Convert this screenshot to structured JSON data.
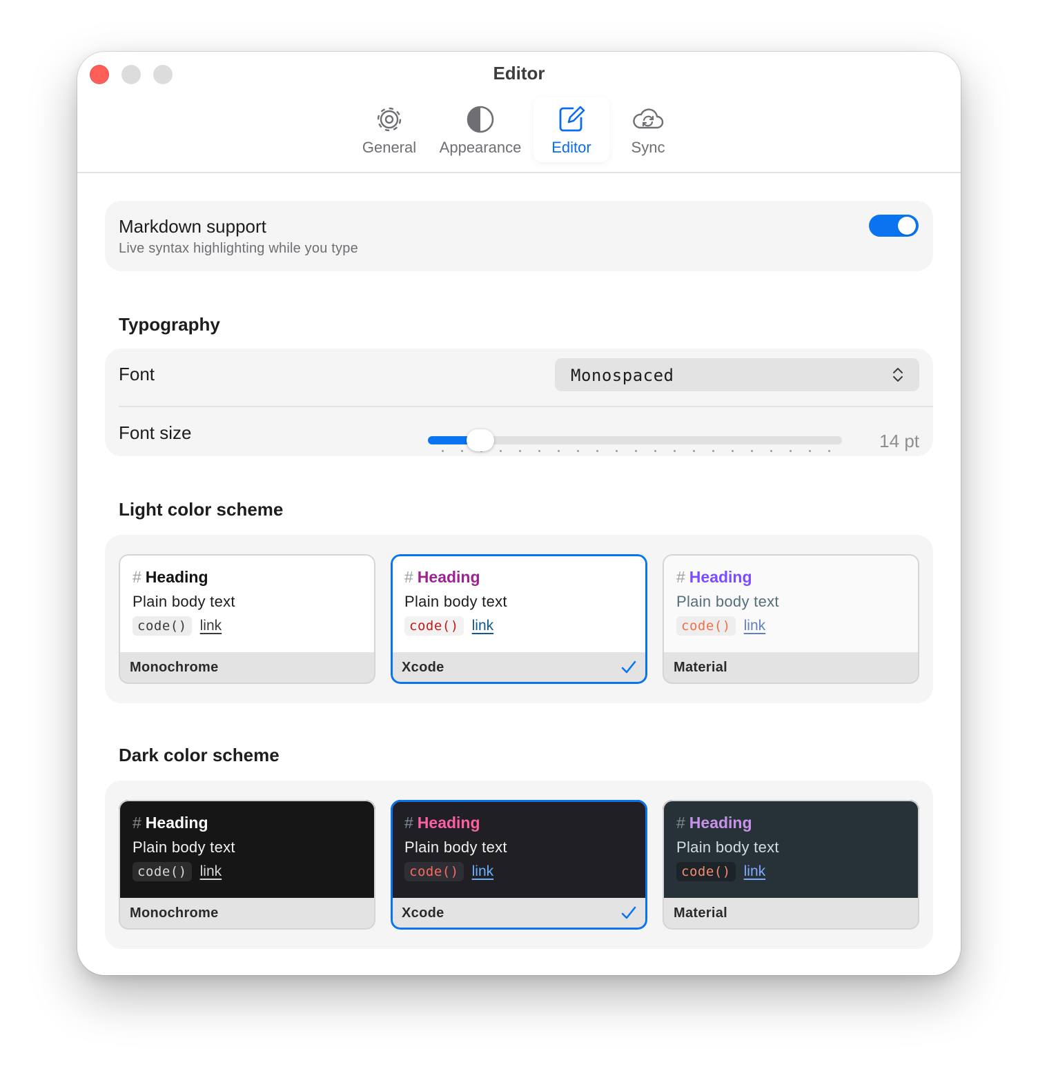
{
  "window": {
    "title": "Editor"
  },
  "tabs": [
    {
      "label": "General",
      "icon": "gear-icon",
      "active": false
    },
    {
      "label": "Appearance",
      "icon": "contrast-icon",
      "active": false
    },
    {
      "label": "Editor",
      "icon": "edit-icon",
      "active": true
    },
    {
      "label": "Sync",
      "icon": "cloud-sync-icon",
      "active": false
    }
  ],
  "markdown": {
    "title": "Markdown support",
    "subtitle": "Live syntax highlighting while you type",
    "enabled": true
  },
  "typography": {
    "heading": "Typography",
    "font_label": "Font",
    "font_value": "Monospaced",
    "size_label": "Font size",
    "size_value": "14 pt",
    "size_fraction": 0.1
  },
  "light": {
    "heading": "Light color scheme",
    "schemes": [
      {
        "name": "Monochrome",
        "hash": "#",
        "heading": "Heading",
        "body": "Plain body text",
        "code": "code()",
        "link": "link",
        "selected": false
      },
      {
        "name": "Xcode",
        "hash": "#",
        "heading": "Heading",
        "body": "Plain body text",
        "code": "code()",
        "link": "link",
        "selected": true
      },
      {
        "name": "Material",
        "hash": "#",
        "heading": "Heading",
        "body": "Plain body text",
        "code": "code()",
        "link": "link",
        "selected": false
      }
    ]
  },
  "dark": {
    "heading": "Dark color scheme",
    "schemes": [
      {
        "name": "Monochrome",
        "hash": "#",
        "heading": "Heading",
        "body": "Plain body text",
        "code": "code()",
        "link": "link",
        "selected": false
      },
      {
        "name": "Xcode",
        "hash": "#",
        "heading": "Heading",
        "body": "Plain body text",
        "code": "code()",
        "link": "link",
        "selected": true
      },
      {
        "name": "Material",
        "hash": "#",
        "heading": "Heading",
        "body": "Plain body text",
        "code": "code()",
        "link": "link",
        "selected": false
      }
    ]
  },
  "colors": {
    "accent": "#0a74f0",
    "close": "#ff5f57"
  }
}
